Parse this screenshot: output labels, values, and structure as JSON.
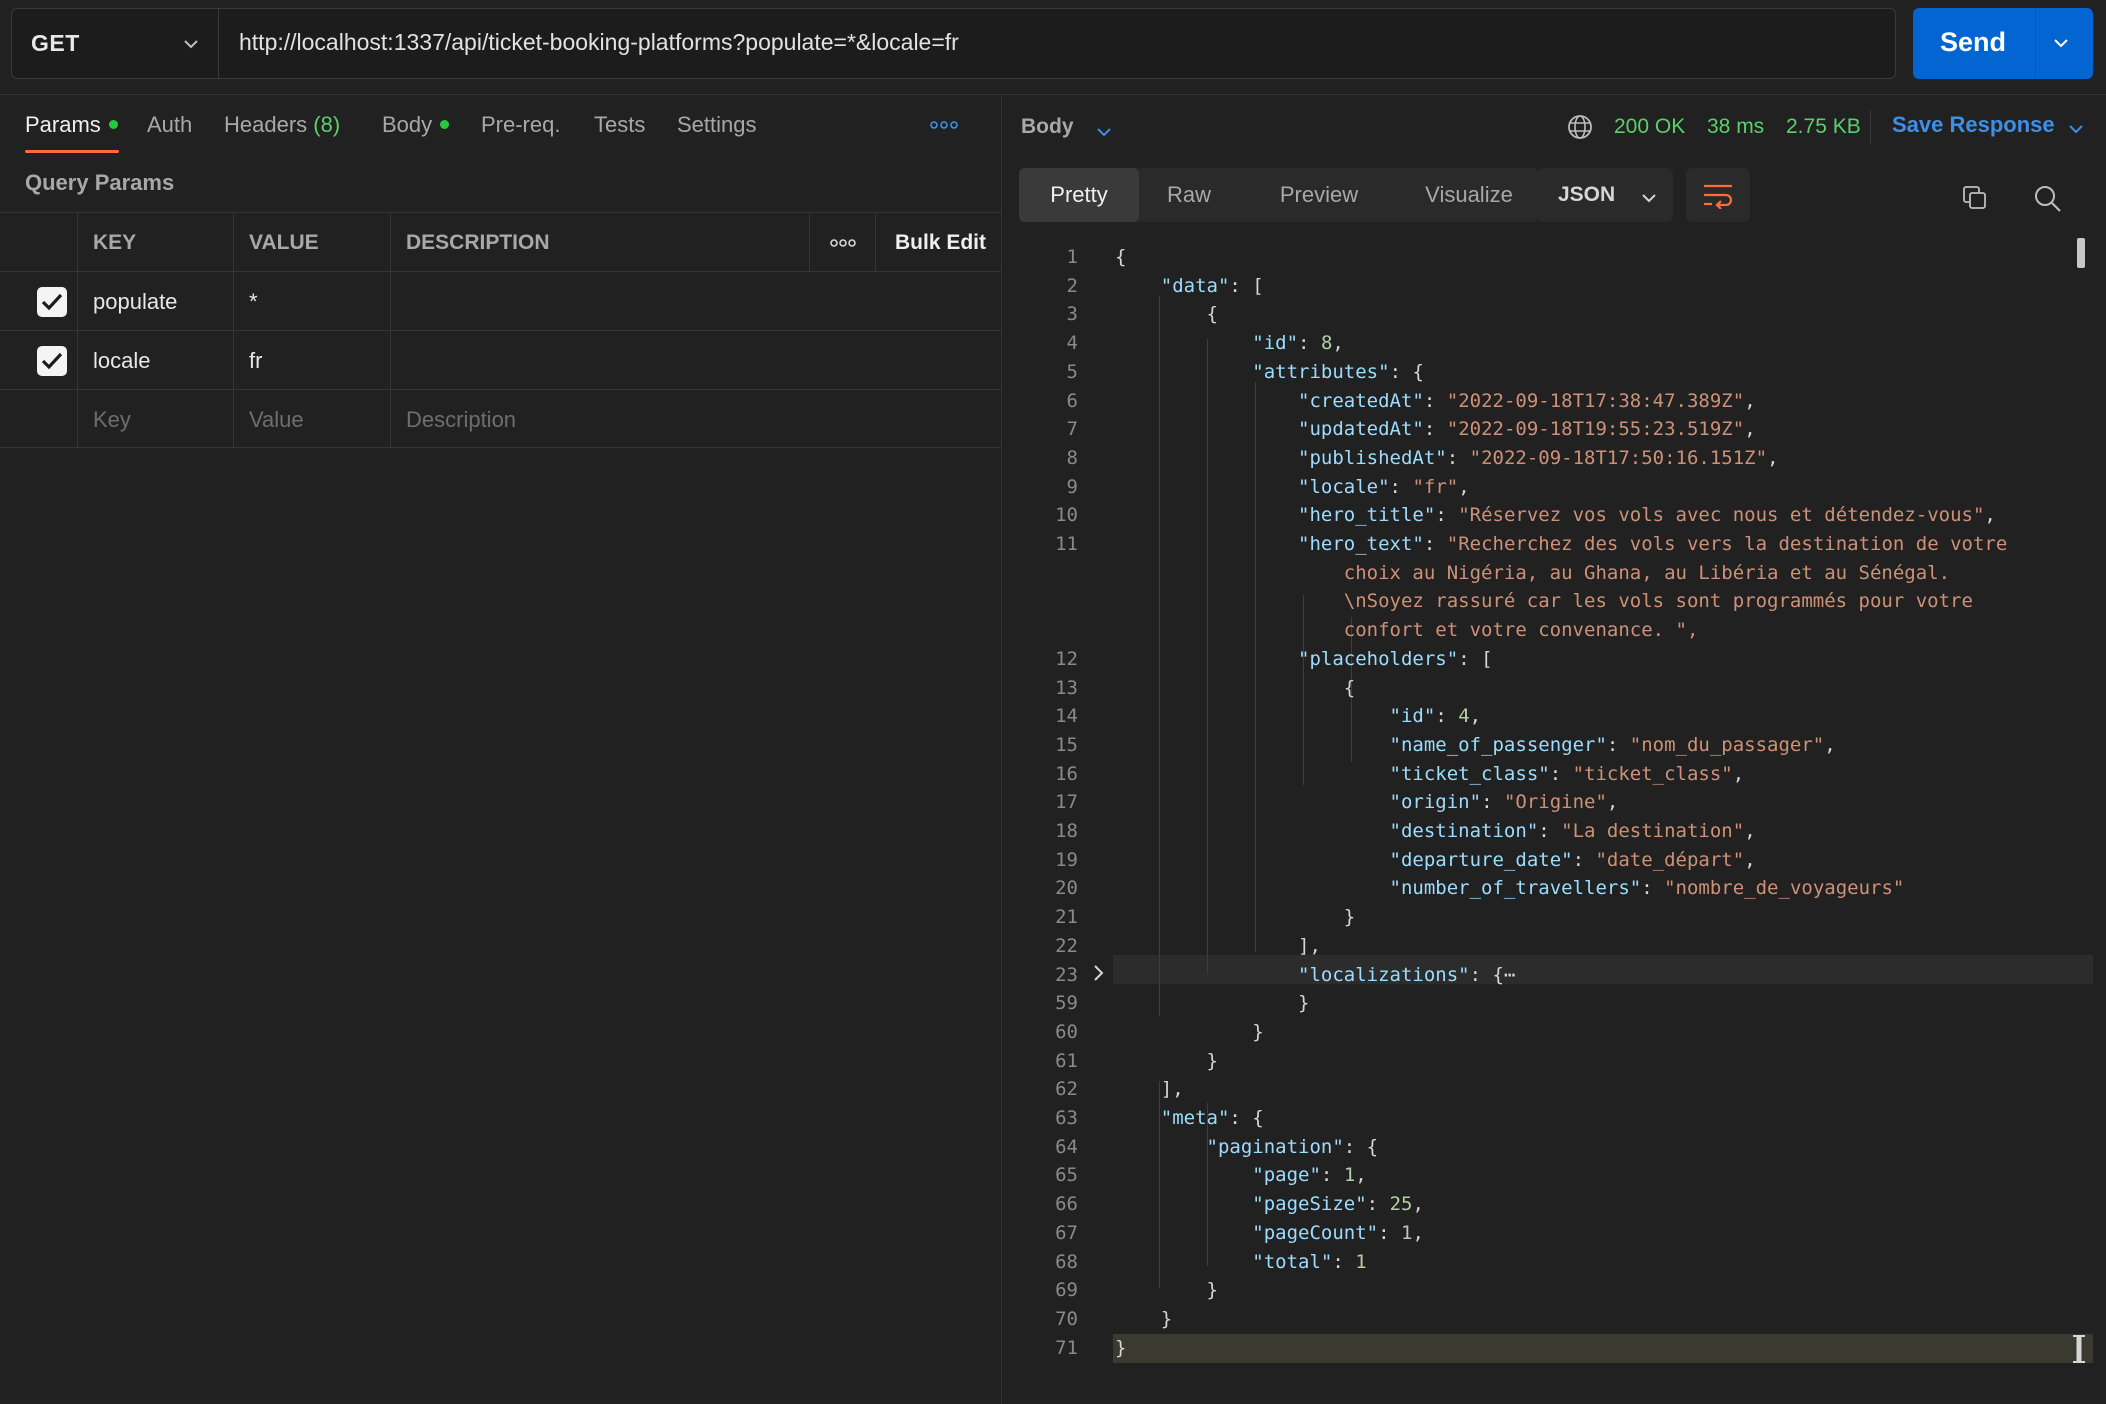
{
  "request": {
    "method": "GET",
    "url": "http://localhost:1337/api/ticket-booking-platforms?populate=*&locale=fr",
    "send_label": "Send"
  },
  "request_tabs": [
    {
      "label": "Params"
    },
    {
      "label": "Auth"
    },
    {
      "label": "Headers",
      "count": "(8)"
    },
    {
      "label": "Body"
    },
    {
      "label": "Pre-req."
    },
    {
      "label": "Tests"
    },
    {
      "label": "Settings"
    }
  ],
  "query_params": {
    "title": "Query Params",
    "headers": {
      "key": "KEY",
      "value": "VALUE",
      "description": "DESCRIPTION",
      "bulk_edit": "Bulk Edit"
    },
    "rows": [
      {
        "key": "populate",
        "value": "*",
        "description": ""
      },
      {
        "key": "locale",
        "value": "fr",
        "description": ""
      }
    ],
    "placeholders": {
      "key": "Key",
      "value": "Value",
      "description": "Description"
    }
  },
  "response": {
    "section_label": "Body",
    "status": "200 OK",
    "time": "38 ms",
    "size": "2.75 KB",
    "save_label": "Save Response",
    "view_tabs": [
      "Pretty",
      "Raw",
      "Preview",
      "Visualize"
    ],
    "format": "JSON"
  },
  "code_lines": [
    {
      "n": "1",
      "t": "{"
    },
    {
      "n": "2",
      "t": "    \"data\": ["
    },
    {
      "n": "3",
      "t": "        {"
    },
    {
      "n": "4",
      "t": "            \"id\": 8,"
    },
    {
      "n": "5",
      "t": "            \"attributes\": {"
    },
    {
      "n": "6",
      "t": "                \"createdAt\": \"2022-09-18T17:38:47.389Z\","
    },
    {
      "n": "7",
      "t": "                \"updatedAt\": \"2022-09-18T19:55:23.519Z\","
    },
    {
      "n": "8",
      "t": "                \"publishedAt\": \"2022-09-18T17:50:16.151Z\","
    },
    {
      "n": "9",
      "t": "                \"locale\": \"fr\","
    },
    {
      "n": "10",
      "t": "                \"hero_title\": \"Réservez vos vols avec nous et détendez-vous\","
    },
    {
      "n": "11",
      "t": "                \"hero_text\": \"Recherchez des vols vers la destination de votre"
    },
    {
      "n": "",
      "t": "                    choix au Nigéria, au Ghana, au Libéria et au Sénégal."
    },
    {
      "n": "",
      "t": "                    \\nSoyez rassuré car les vols sont programmés pour votre"
    },
    {
      "n": "",
      "t": "                    confort et votre convenance. \","
    },
    {
      "n": "12",
      "t": "                \"placeholders\": ["
    },
    {
      "n": "13",
      "t": "                    {"
    },
    {
      "n": "14",
      "t": "                        \"id\": 4,"
    },
    {
      "n": "15",
      "t": "                        \"name_of_passenger\": \"nom_du_passager\","
    },
    {
      "n": "16",
      "t": "                        \"ticket_class\": \"ticket_class\","
    },
    {
      "n": "17",
      "t": "                        \"origin\": \"Origine\","
    },
    {
      "n": "18",
      "t": "                        \"destination\": \"La destination\","
    },
    {
      "n": "19",
      "t": "                        \"departure_date\": \"date_départ\","
    },
    {
      "n": "20",
      "t": "                        \"number_of_travellers\": \"nombre_de_voyageurs\""
    },
    {
      "n": "21",
      "t": "                    }"
    },
    {
      "n": "22",
      "t": "                ],"
    },
    {
      "n": "23",
      "t": "                \"localizations\": {⋯"
    },
    {
      "n": "59",
      "t": "                }"
    },
    {
      "n": "60",
      "t": "            }"
    },
    {
      "n": "61",
      "t": "        }"
    },
    {
      "n": "62",
      "t": "    ],"
    },
    {
      "n": "63",
      "t": "    \"meta\": {"
    },
    {
      "n": "64",
      "t": "        \"pagination\": {"
    },
    {
      "n": "65",
      "t": "            \"page\": 1,"
    },
    {
      "n": "66",
      "t": "            \"pageSize\": 25,"
    },
    {
      "n": "67",
      "t": "            \"pageCount\": 1,"
    },
    {
      "n": "68",
      "t": "            \"total\": 1"
    },
    {
      "n": "69",
      "t": "        }"
    },
    {
      "n": "70",
      "t": "    }"
    },
    {
      "n": "71",
      "t": "}"
    }
  ],
  "colors": {
    "accent_tab": "#ff6c37",
    "send_button": "#0265d2",
    "status_ok": "#5ccf6b",
    "link_blue": "#3d8fe8",
    "json_key": "#9cdcfe",
    "json_string": "#ce9178",
    "json_number": "#b5cea8"
  },
  "icons": [
    "chevron-down-icon",
    "more-horizontal-icon",
    "checkbox-checked-icon",
    "globe-icon",
    "wrap-lines-icon",
    "copy-icon",
    "search-icon",
    "fold-arrow-icon"
  ]
}
